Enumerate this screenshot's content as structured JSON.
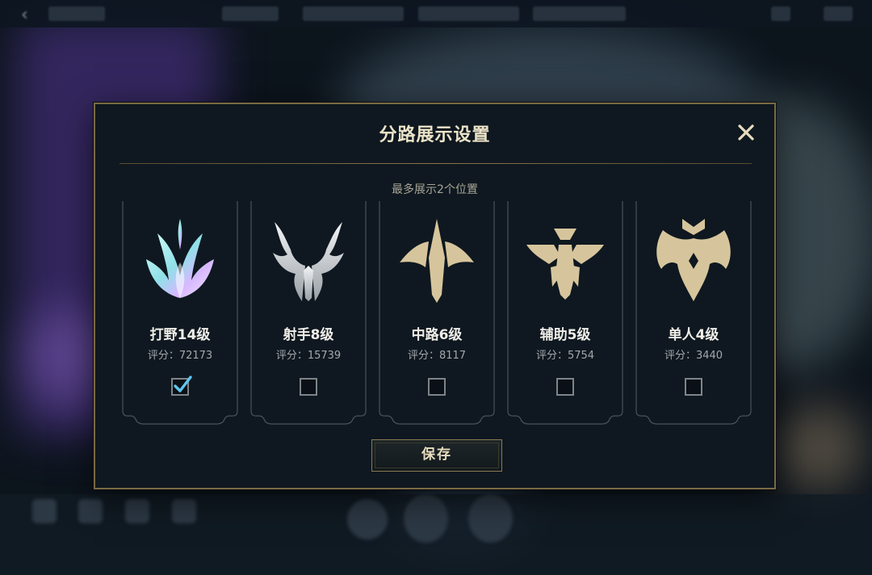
{
  "modal": {
    "title": "分路展示设置",
    "subtitle": "最多展示2个位置",
    "save_label": "保存"
  },
  "roles": [
    {
      "name": "jungle",
      "level": "打野14级",
      "score": "评分：72173",
      "checked": true,
      "emblem": "jungle-claw-icon"
    },
    {
      "name": "marksman",
      "level": "射手8级",
      "score": "评分：15739",
      "checked": false,
      "emblem": "marksman-icon"
    },
    {
      "name": "mid",
      "level": "中路6级",
      "score": "评分：8117",
      "checked": false,
      "emblem": "mid-lane-icon"
    },
    {
      "name": "support",
      "level": "辅助5级",
      "score": "评分：5754",
      "checked": false,
      "emblem": "support-icon"
    },
    {
      "name": "solo",
      "level": "单人4级",
      "score": "评分：3440",
      "checked": false,
      "emblem": "solo-lane-icon"
    }
  ],
  "colors": {
    "gold": "#d8c594",
    "border": "#7a6a42",
    "check": "#5fc6f0",
    "silver": "#c9ccd0"
  }
}
